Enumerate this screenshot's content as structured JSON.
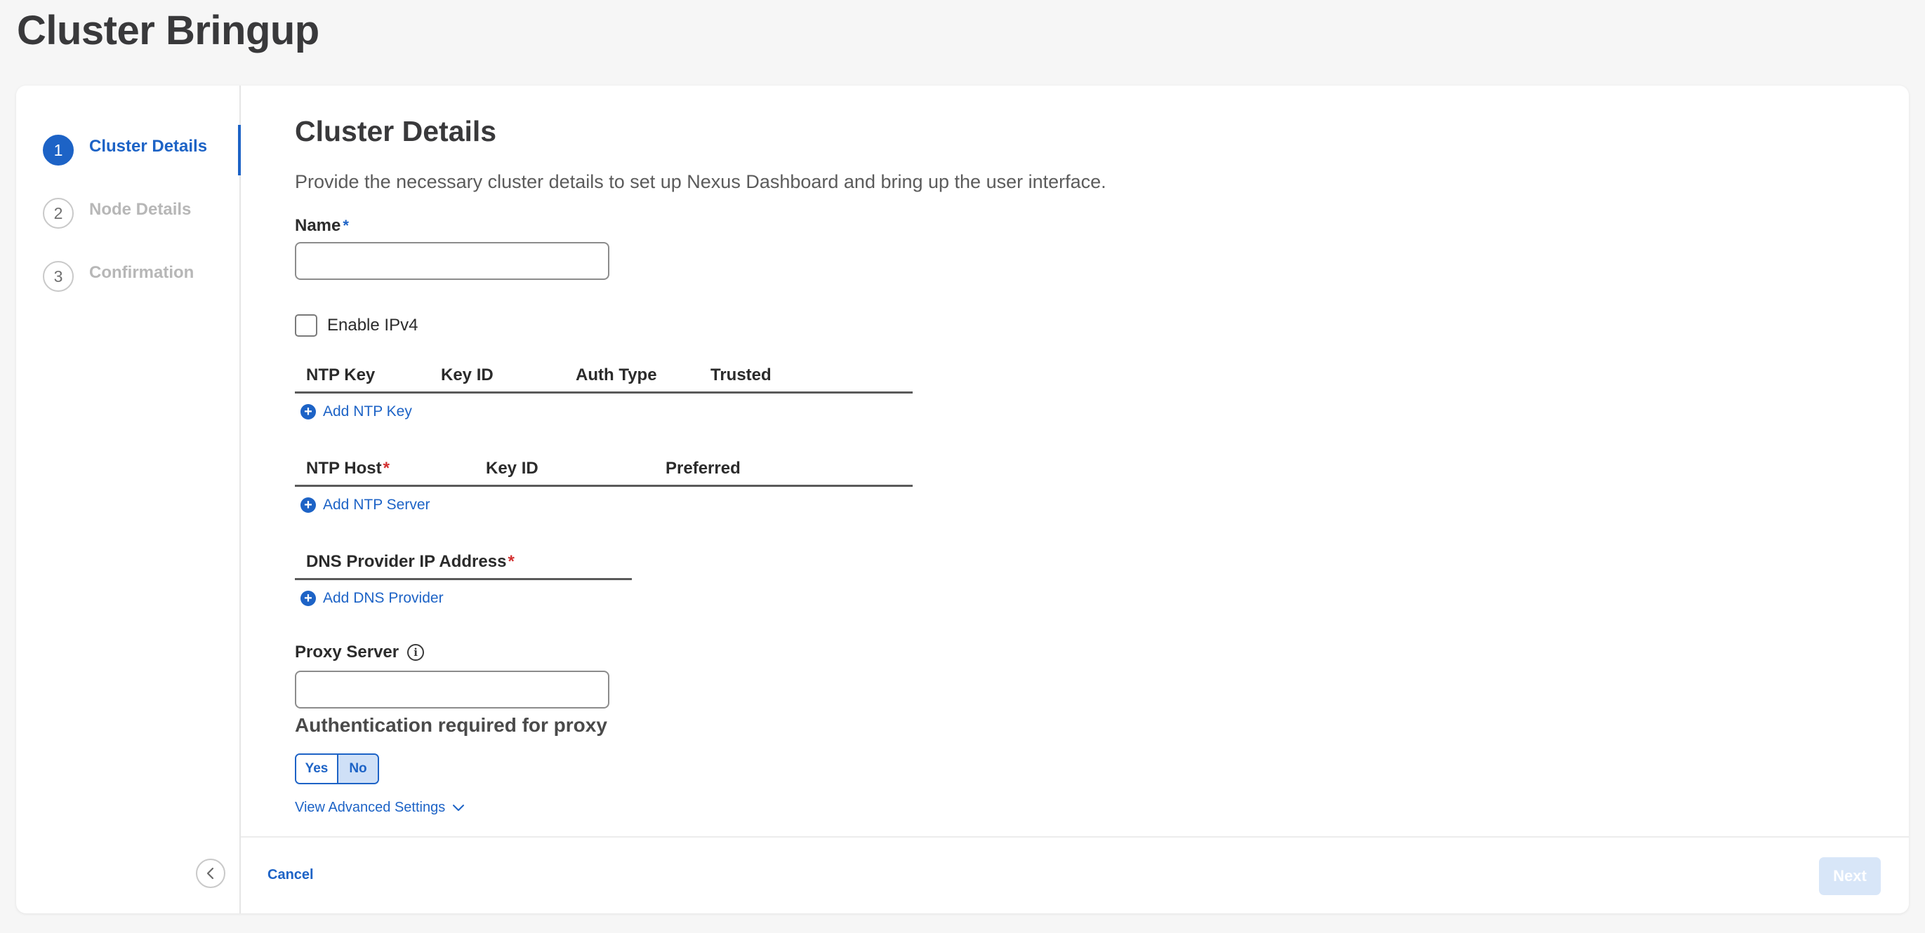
{
  "page": {
    "title": "Cluster Bringup"
  },
  "steps": [
    {
      "number": "1",
      "label": "Cluster Details",
      "active": true
    },
    {
      "number": "2",
      "label": "Node Details",
      "active": false
    },
    {
      "number": "3",
      "label": "Confirmation",
      "active": false
    }
  ],
  "form": {
    "title": "Cluster Details",
    "description": "Provide the necessary cluster details to set up Nexus Dashboard and bring up the user interface.",
    "name_label": "Name",
    "name_required_marker": "*",
    "name_value": "",
    "enable_ipv4_label": "Enable IPv4",
    "ntp_key_table": {
      "columns": [
        "NTP Key",
        "Key ID",
        "Auth Type",
        "Trusted"
      ],
      "add_label": "Add NTP Key"
    },
    "ntp_host_table": {
      "columns": [
        "NTP Host",
        "Key ID",
        "Preferred"
      ],
      "required_marker": "*",
      "add_label": "Add NTP Server"
    },
    "dns_table": {
      "columns": [
        "DNS Provider IP Address"
      ],
      "required_marker": "*",
      "add_label": "Add DNS Provider"
    },
    "proxy_label": "Proxy Server",
    "proxy_value": "",
    "auth_title": "Authentication required for proxy",
    "auth_options": [
      "Yes",
      "No"
    ],
    "auth_selected": "No",
    "advanced_link": "View Advanced Settings"
  },
  "footer": {
    "cancel_label": "Cancel",
    "next_label": "Next"
  },
  "colors": {
    "accent": "#1d63c6",
    "required": "#d32f2f",
    "disabled_button": "#d8e6f8"
  },
  "icons": [
    "plus-circle-icon",
    "info-icon",
    "chevron-down-icon",
    "chevron-left-icon"
  ]
}
